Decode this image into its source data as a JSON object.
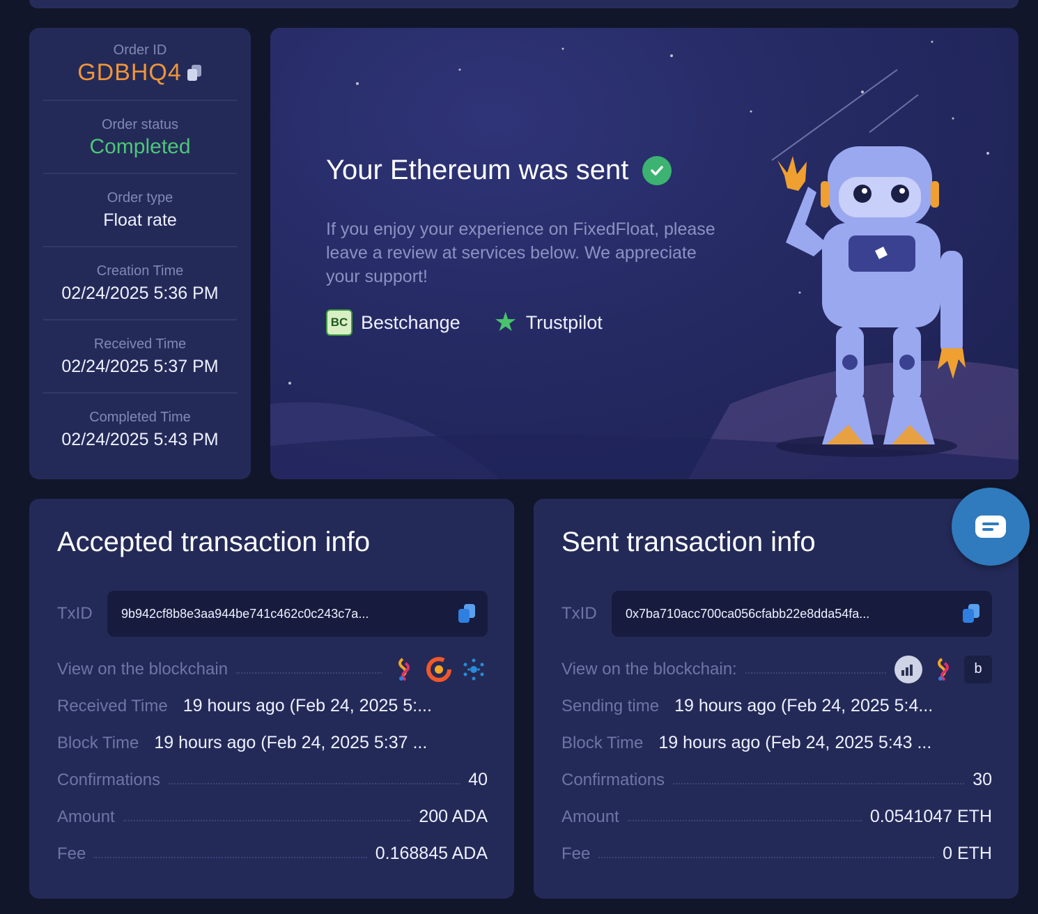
{
  "order": {
    "id_label": "Order ID",
    "id_value": "GDBHQ4",
    "status_label": "Order status",
    "status_value": "Completed",
    "type_label": "Order type",
    "type_value": "Float rate",
    "creation_label": "Creation Time",
    "creation_value": "02/24/2025 5:36 PM",
    "received_label": "Received Time",
    "received_value": "02/24/2025 5:37 PM",
    "completed_label": "Completed Time",
    "completed_value": "02/24/2025 5:43 PM"
  },
  "hero": {
    "title": "Your Ethereum was sent",
    "message": "If you enjoy your experience on FixedFloat, please leave a review at services below. We appreciate your support!",
    "review_links": [
      "Bestchange",
      "Trustpilot"
    ]
  },
  "accepted": {
    "title": "Accepted transaction info",
    "txid_label": "TxID",
    "txid_value": "9b942cf8b8e3aa944be741c462c0c243c7a...",
    "view_label": "View on the blockchain",
    "time_label": "Received Time",
    "time_value": "19 hours ago (Feb 24, 2025 5:...",
    "block_label": "Block Time",
    "block_value": "19 hours ago (Feb 24, 2025 5:37 ...",
    "conf_label": "Confirmations",
    "conf_value": "40",
    "amount_label": "Amount",
    "amount_value": "200 ADA",
    "fee_label": "Fee",
    "fee_value": "0.168845 ADA"
  },
  "sent": {
    "title": "Sent transaction info",
    "txid_label": "TxID",
    "txid_value": "0x7ba710acc700ca056cfabb22e8dda54fa...",
    "view_label": "View on the blockchain:",
    "time_label": "Sending time",
    "time_value": "19 hours ago (Feb 24, 2025 5:4...",
    "block_label": "Block Time",
    "block_value": "19 hours ago (Feb 24, 2025 5:43 ...",
    "conf_label": "Confirmations",
    "conf_value": "30",
    "amount_label": "Amount",
    "amount_value": "0.0541047 ETH",
    "fee_label": "Fee",
    "fee_value": "0 ETH",
    "explorer_b": "b"
  },
  "colors": {
    "background": "#12162a",
    "card": "#242a58",
    "order_id": "#f0953a",
    "status_completed": "#4cc778",
    "chat_button": "#2f7bbd"
  }
}
